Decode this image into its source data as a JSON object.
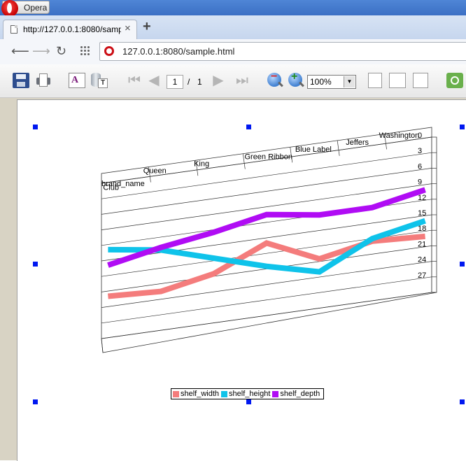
{
  "browser": {
    "menu_label": "Opera",
    "tab_title": "http://127.0.0.1:8080/samp",
    "tab_close": "×",
    "new_tab": "+",
    "address": "127.0.0.1:8080/sample.html"
  },
  "toolbar": {
    "font_glyph": "A",
    "db_glyph": "T",
    "page_current": "1",
    "page_separator": "/",
    "page_total": "1",
    "zoom": "100%",
    "zoom_arrow": "▼"
  },
  "chart_data": {
    "type": "line",
    "categories": [
      "Club",
      "Queen",
      "King",
      "Green Ribbon",
      "Blue Label",
      "Jeffers",
      "Washington"
    ],
    "series_axis_label": "brand_name",
    "y_ticks": [
      "0",
      "3",
      "6",
      "9",
      "12",
      "15",
      "18",
      "21",
      "24",
      "27"
    ],
    "ylim": [
      0,
      30
    ],
    "grid": true,
    "legend_position": "bottom",
    "series": [
      {
        "name": "shelf_width",
        "color": "#f47c7c",
        "values": [
          22,
          22.5,
          20.5,
          16,
          20.5,
          18.5,
          19
        ]
      },
      {
        "name": "shelf_height",
        "color": "#0fc3ea",
        "values": [
          13,
          14.5,
          17.5,
          20.5,
          23,
          18,
          16
        ]
      },
      {
        "name": "shelf_depth",
        "color": "#b00cf4",
        "values": [
          16,
          14,
          12.5,
          10.5,
          12,
          12,
          10
        ]
      }
    ]
  }
}
